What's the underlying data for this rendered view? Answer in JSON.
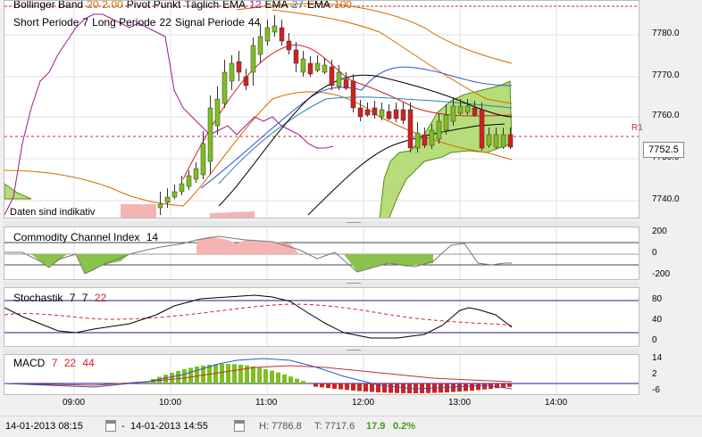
{
  "main_legend": {
    "line1": [
      {
        "text": "Bollinger Band",
        "color": "#000000"
      },
      {
        "text": "20",
        "color": "#d46a00"
      },
      {
        "text": "2.00",
        "color": "#d46a00"
      },
      {
        "text": "Pivot Punkt",
        "color": "#000000"
      },
      {
        "text": "Täglich",
        "color": "#000000"
      },
      {
        "text": "EMA",
        "color": "#000000"
      },
      {
        "text": "12",
        "color": "#9b1b8f"
      },
      {
        "text": "EMA",
        "color": "#000000"
      },
      {
        "text": "27",
        "color": "#2c7fb8"
      },
      {
        "text": "EMA",
        "color": "#000000"
      },
      {
        "text": "100",
        "color": "#d46a00"
      }
    ],
    "line2": [
      {
        "text": "Short Periode",
        "color": "#000000"
      },
      {
        "text": "7",
        "color": "#000000"
      },
      {
        "text": "Long Periode",
        "color": "#000000"
      },
      {
        "text": "22",
        "color": "#000000"
      },
      {
        "text": "Signal Periode",
        "color": "#000000"
      },
      {
        "text": "44",
        "color": "#000000"
      }
    ]
  },
  "main_axis": {
    "ticks": [
      "7780.0",
      "7770.0",
      "7760.0",
      "7750.0",
      "7740.0"
    ],
    "pivot_label": "R1",
    "last_price": "7752.5"
  },
  "disclaimer": "Daten sind indikativ",
  "cci": {
    "name": "Commodity Channel Index",
    "period": "14",
    "ticks": [
      "200",
      "0",
      "-200"
    ]
  },
  "stoch": {
    "name": "Stochastik",
    "p1": "7",
    "p2": "7",
    "p3": "22",
    "ticks": [
      "80",
      "40",
      "0"
    ]
  },
  "macd": {
    "name": "MACD",
    "p1": "7",
    "p2": "22",
    "p3": "44",
    "ticks": [
      "14",
      "2",
      "-6"
    ]
  },
  "time_axis": [
    "09:00",
    "10:00",
    "11:00",
    "12:00",
    "13:00",
    "14:00"
  ],
  "status": {
    "from": "14-01-2013 08:15",
    "to": "14-01-2013 14:55",
    "high": "H: 7786.8",
    "low": "T: 7717.6",
    "change": "17.9",
    "change_pct": "0.2%"
  },
  "colors": {
    "up": "#7fbf1f",
    "down": "#d42020",
    "accent": "#1a1a9c"
  },
  "chart_data": {
    "type": "line",
    "title": "",
    "x": [
      "09:00",
      "10:00",
      "11:00",
      "12:00",
      "13:00",
      "14:00"
    ],
    "ylim": [
      7732,
      7788
    ],
    "last": 7752.5
  }
}
